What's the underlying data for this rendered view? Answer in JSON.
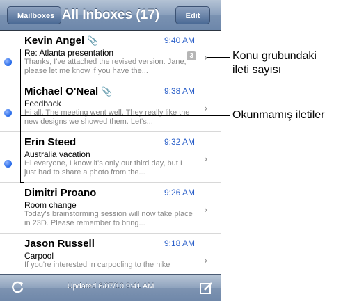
{
  "navbar": {
    "back_label": "Mailboxes",
    "title": "All Inboxes (17)",
    "edit_label": "Edit"
  },
  "messages": [
    {
      "sender": "Kevin Angel",
      "time": "9:40 AM",
      "subject": "Re: Atlanta presentation",
      "preview": "Thanks, I've attached the revised version. Jane, please let me know if you have the...",
      "unread": true,
      "attachment": true,
      "thread_count": "3"
    },
    {
      "sender": "Michael O'Neal",
      "time": "9:38 AM",
      "subject": "Feedback",
      "preview": "Hi all, The meeting went well. They really like the new designs we showed them. Let's...",
      "unread": true,
      "attachment": true,
      "thread_count": ""
    },
    {
      "sender": "Erin Steed",
      "time": "9:32 AM",
      "subject": "Australia vacation",
      "preview": "Hi everyone, I know it's only our third day, but I just had to share a photo from the...",
      "unread": true,
      "attachment": false,
      "thread_count": ""
    },
    {
      "sender": "Dimitri Proano",
      "time": "9:26 AM",
      "subject": "Room change",
      "preview": "Today's brainstorming session will now take place in 23D. Please remember to bring...",
      "unread": false,
      "attachment": false,
      "thread_count": ""
    },
    {
      "sender": "Jason Russell",
      "time": "9:18 AM",
      "subject": "Carpool",
      "preview": "If you're interested in carpooling to the hike",
      "unread": false,
      "attachment": false,
      "thread_count": ""
    }
  ],
  "toolbar": {
    "updated_text": "Updated 6/07/10 9:41 AM",
    "refresh_icon": "refresh-icon",
    "compose_icon": "compose-icon"
  },
  "callouts": {
    "thread_count_label_line1": "Konu grubundaki",
    "thread_count_label_line2": "ileti sayısı",
    "unread_label": "Okunmamış iletiler"
  },
  "colors": {
    "accent": "#2a5fc9",
    "unread_dot": "#2368e8",
    "navbar": "#7a92b2"
  }
}
